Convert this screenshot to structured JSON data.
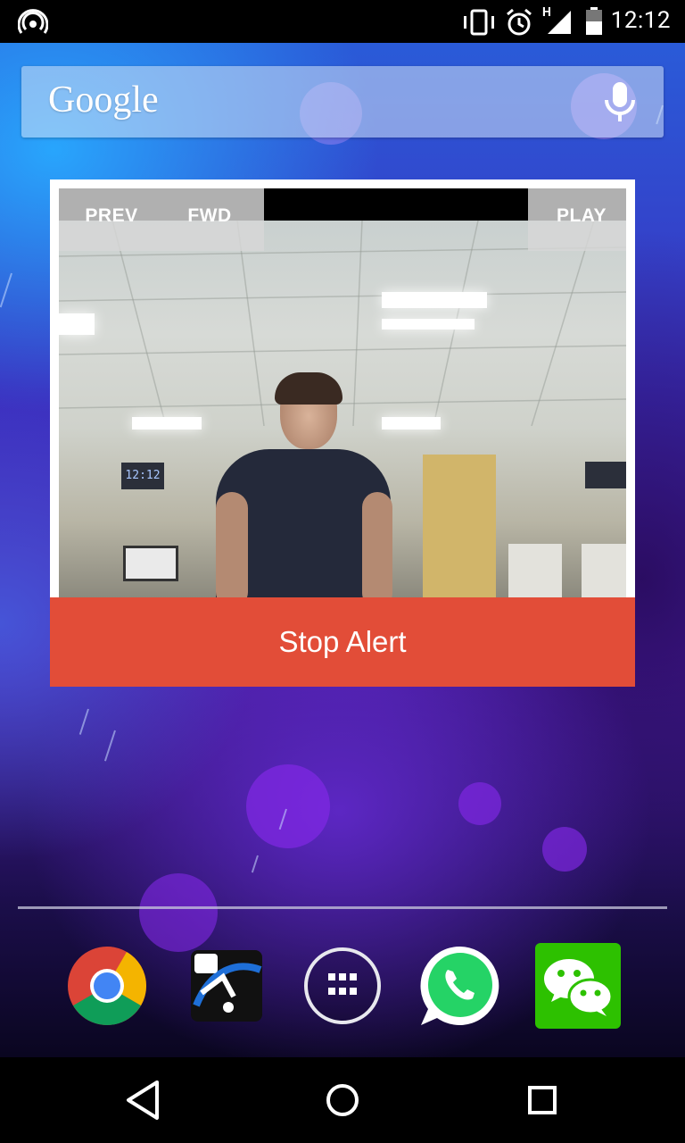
{
  "status_bar": {
    "time": "12:12",
    "signal_type": "H",
    "icons": [
      "hotspot-icon",
      "vibrate-icon",
      "alarm-icon",
      "signal-icon",
      "battery-icon"
    ]
  },
  "search_bar": {
    "logo_text": "Google",
    "mic_icon": "mic-icon"
  },
  "widget": {
    "controls": {
      "prev_label": "PREV",
      "fwd_label": "FWD",
      "play_label": "PLAY"
    },
    "camera_overlay_clock": "12:12",
    "stop_alert_label": "Stop Alert",
    "accent_color": "#e24d38"
  },
  "dock": {
    "apps": [
      {
        "name": "chrome",
        "icon": "chrome-icon"
      },
      {
        "name": "app-2",
        "icon": "app-icon"
      },
      {
        "name": "app-drawer",
        "icon": "app-drawer-icon"
      },
      {
        "name": "whatsapp",
        "icon": "whatsapp-icon"
      },
      {
        "name": "wechat",
        "icon": "wechat-icon"
      }
    ]
  },
  "nav_bar": {
    "buttons": [
      "back-icon",
      "home-icon",
      "recents-icon"
    ]
  }
}
